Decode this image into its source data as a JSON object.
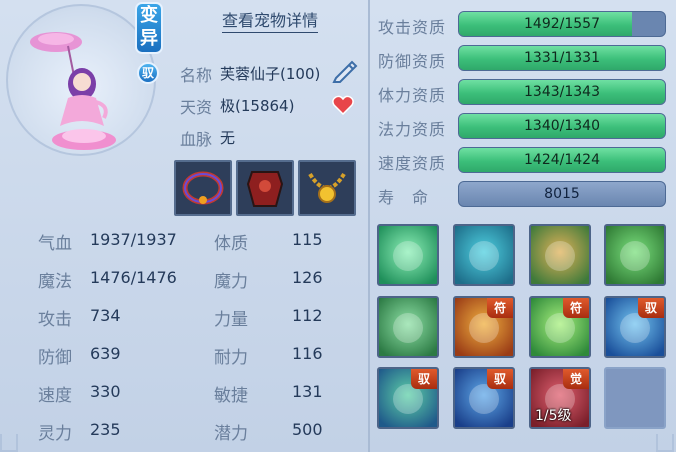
{
  "header": {
    "view_details": "查看宠物详情"
  },
  "badges": {
    "variant": "变异",
    "tamed": "驭"
  },
  "pet": {
    "name_label": "名称",
    "name_value": "芙蓉仙子(100)",
    "talent_label": "天资",
    "talent_value": "极(15864)",
    "bloodline_label": "血脉",
    "bloodline_value": "无"
  },
  "equipment": [
    {
      "name": "necklace-ring-icon"
    },
    {
      "name": "armor-icon"
    },
    {
      "name": "gold-chain-icon"
    }
  ],
  "stats_left": [
    {
      "label": "气血",
      "value": "1937/1937"
    },
    {
      "label": "魔法",
      "value": "1476/1476"
    },
    {
      "label": "攻击",
      "value": "734"
    },
    {
      "label": "防御",
      "value": "639"
    },
    {
      "label": "速度",
      "value": "330"
    },
    {
      "label": "灵力",
      "value": "235"
    }
  ],
  "stats_right": [
    {
      "label": "体质",
      "value": "115"
    },
    {
      "label": "魔力",
      "value": "126"
    },
    {
      "label": "力量",
      "value": "112"
    },
    {
      "label": "耐力",
      "value": "116"
    },
    {
      "label": "敏捷",
      "value": "131"
    },
    {
      "label": "潜力",
      "value": "500"
    }
  ],
  "aptitudes": [
    {
      "label": "攻击资质",
      "value": "1492/1557",
      "fill": 0.84
    },
    {
      "label": "防御资质",
      "value": "1331/1331",
      "fill": 1.0
    },
    {
      "label": "体力资质",
      "value": "1343/1343",
      "fill": 1.0
    },
    {
      "label": "法力资质",
      "value": "1340/1340",
      "fill": 1.0
    },
    {
      "label": "速度资质",
      "value": "1424/1424",
      "fill": 1.0
    }
  ],
  "lifespan": {
    "label": "寿　命",
    "value": "8015"
  },
  "skills": [
    {
      "name": "wing-skill-icon",
      "tag": "",
      "level": ""
    },
    {
      "name": "shadow-figure-skill-icon",
      "tag": "",
      "level": ""
    },
    {
      "name": "boot-skill-icon",
      "tag": "",
      "level": ""
    },
    {
      "name": "horse-skill-icon",
      "tag": "",
      "level": ""
    },
    {
      "name": "shield-swirl-skill-icon",
      "tag": "",
      "level": ""
    },
    {
      "name": "rune-totem-skill-icon",
      "tag": "符",
      "level": ""
    },
    {
      "name": "heart-wings-skill-icon",
      "tag": "符",
      "level": ""
    },
    {
      "name": "water-orb-skill-icon",
      "tag": "驭",
      "level": ""
    },
    {
      "name": "shield-skill-icon",
      "tag": "驭",
      "level": ""
    },
    {
      "name": "blue-shield-skill-icon",
      "tag": "驭",
      "level": ""
    },
    {
      "name": "awakened-skill-icon",
      "tag": "觉",
      "level": "1/5级"
    },
    {
      "name": "empty-skill-slot",
      "tag": "",
      "level": ""
    }
  ],
  "colors": {
    "bar_fill": "#3cbf7a",
    "bar_bg": "#6a86b0",
    "tag_bg": "#c0401a",
    "accent": "#1a6fbf"
  }
}
